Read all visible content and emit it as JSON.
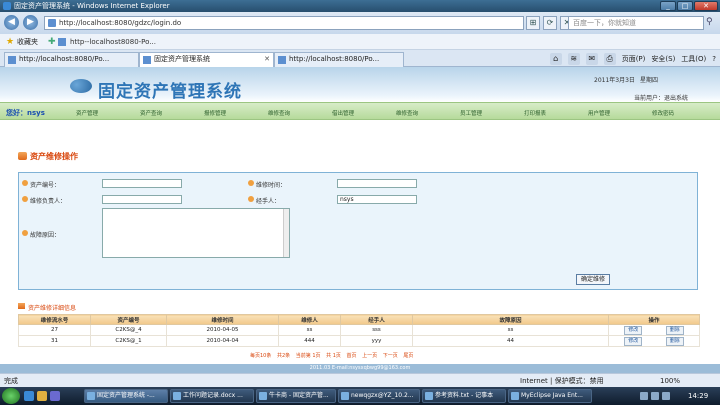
{
  "window": {
    "title": "固定资产管理系统 - Windows Internet Explorer"
  },
  "address": {
    "url": "http://localhost:8080/gdzc/login.do",
    "search_placeholder": "百度一下，你就知道"
  },
  "favorites": {
    "label": "收藏夹",
    "link": "http--localhost8080-Po..."
  },
  "tabs": [
    {
      "label": "http://localhost:8080/Po..."
    },
    {
      "label": "固定资产管理系统"
    },
    {
      "label": "http://localhost:8080/Po..."
    }
  ],
  "commandbar": {
    "page": "页面(P)",
    "safety": "安全(S)",
    "tools": "工具(O)",
    "help": "?"
  },
  "header": {
    "title": "固定资产管理系统",
    "date": "2011年3月3日",
    "weekday": "星期四",
    "user_info": "当前用户：退出系统"
  },
  "nav": {
    "user": "您好：nsys",
    "items": [
      "资产管理",
      "资产查询",
      "报修管理",
      "维修查询",
      "借出管理",
      "维修查询",
      "员工管理",
      "打印报表",
      "用户管理",
      "修改密码"
    ]
  },
  "form": {
    "heading": "资产维修操作",
    "asset_no_label": "资产编号：",
    "repair_time_label": "维修时间：",
    "repair_person_label": "维修负责人：",
    "operator_label": "经手人：",
    "operator_value": "nsys",
    "fault_label": "故障原因：",
    "submit": "确定维修"
  },
  "table": {
    "heading": "资产维修详细信息",
    "headers": [
      "维修流水号",
      "资产编号",
      "维修时间",
      "维修人",
      "经手人",
      "故障原因",
      "操作"
    ],
    "rows": [
      {
        "id": "27",
        "asset": "C2KS@_4",
        "time": "2010-04-05",
        "person": "ss",
        "operator": "sss",
        "reason": "ss",
        "edit": "修改",
        "delete": "删除"
      },
      {
        "id": "31",
        "asset": "C2KS@_1",
        "time": "2010-04-04",
        "person": "444",
        "operator": "yyy",
        "reason": "44",
        "edit": "修改",
        "delete": "删除"
      }
    ],
    "pager": [
      "每页10条",
      "共2条",
      "当前第 1页",
      "共 1页",
      "首页",
      "上一页",
      "下一页",
      "尾页"
    ]
  },
  "footer": {
    "text": "2011.03 E-mail:nsysxqbwg99@163.com"
  },
  "status": {
    "left": "完成",
    "zone": "Internet | 保护模式：禁用",
    "zoom": "100%"
  },
  "taskbar": {
    "items": [
      "固定资产管理系统 -...",
      "工作问题记录.docx ...",
      "牛卡商 - 固定资产管...",
      "newqgzx@YZ_10.2...",
      "参考资料.txt - 记事本",
      "MyEclipse Java Ent..."
    ],
    "clock": "14:29"
  }
}
